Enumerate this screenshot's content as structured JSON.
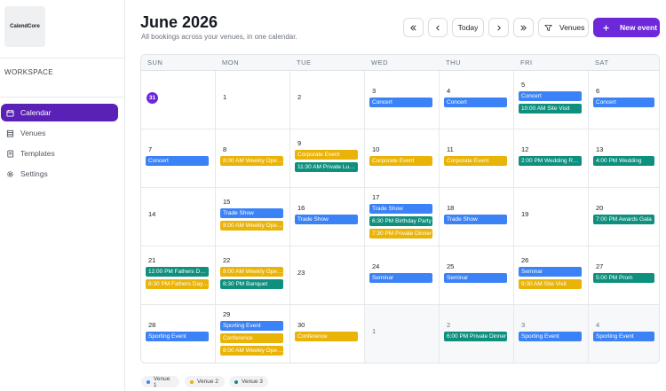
{
  "sidebar": {
    "logo": "CalendCore",
    "workspace_label": "WORKSPACE",
    "items": [
      {
        "label": "Calendar",
        "icon": "calendar-icon"
      },
      {
        "label": "Venues",
        "icon": "building-icon"
      },
      {
        "label": "Templates",
        "icon": "template-icon"
      },
      {
        "label": "Settings",
        "icon": "gear-icon"
      }
    ]
  },
  "header": {
    "title": "June 2026",
    "subtitle": "All bookings across your venues, in one calendar.",
    "today_label": "Today",
    "venues_label": "Venues",
    "new_event_label": "New event"
  },
  "calendar": {
    "weekdays": [
      "SUN",
      "MON",
      "TUE",
      "WED",
      "THU",
      "FRI",
      "SAT"
    ],
    "weeks": [
      [
        {
          "day": "31",
          "today": true,
          "events": []
        },
        {
          "day": "1",
          "events": []
        },
        {
          "day": "2",
          "events": []
        },
        {
          "day": "3",
          "events": [
            {
              "text": "Concert",
              "venue": 1
            }
          ]
        },
        {
          "day": "4",
          "events": [
            {
              "text": "Concert",
              "venue": 1
            }
          ]
        },
        {
          "day": "5",
          "events": [
            {
              "text": "Concert",
              "venue": 1
            },
            {
              "text": "10:00 AM Site Visit",
              "venue": 3
            }
          ]
        },
        {
          "day": "6",
          "events": [
            {
              "text": "Concert",
              "venue": 1
            }
          ]
        }
      ],
      [
        {
          "day": "7",
          "events": [
            {
              "text": "Concert",
              "venue": 1
            }
          ]
        },
        {
          "day": "8",
          "events": [
            {
              "text": "8:00 AM Weekly Oper...",
              "venue": 2
            }
          ]
        },
        {
          "day": "9",
          "events": [
            {
              "text": "Corporate Event",
              "venue": 2
            },
            {
              "text": "11:30 AM Private Lunch",
              "venue": 3
            }
          ]
        },
        {
          "day": "10",
          "events": [
            {
              "text": "Corporate Event",
              "venue": 2
            }
          ]
        },
        {
          "day": "11",
          "events": [
            {
              "text": "Corporate Event",
              "venue": 2
            }
          ]
        },
        {
          "day": "12",
          "events": [
            {
              "text": "2:00 PM Wedding Reh...",
              "venue": 3
            }
          ]
        },
        {
          "day": "13",
          "events": [
            {
              "text": "4:00 PM Wedding",
              "venue": 3
            }
          ]
        }
      ],
      [
        {
          "day": "14",
          "events": []
        },
        {
          "day": "15",
          "events": [
            {
              "text": "Trade Show",
              "venue": 1
            },
            {
              "text": "8:00 AM Weekly Oper...",
              "venue": 2
            }
          ]
        },
        {
          "day": "16",
          "events": [
            {
              "text": "Trade Show",
              "venue": 1
            }
          ]
        },
        {
          "day": "17",
          "events": [
            {
              "text": "Trade Show",
              "venue": 1
            },
            {
              "text": "6:30 PM Birthday Party",
              "venue": 3
            },
            {
              "text": "7:30 PM Private Dinner",
              "venue": 2
            }
          ]
        },
        {
          "day": "18",
          "events": [
            {
              "text": "Trade Show",
              "venue": 1
            }
          ]
        },
        {
          "day": "19",
          "events": []
        },
        {
          "day": "20",
          "events": [
            {
              "text": "7:00 PM Awards Gala",
              "venue": 3
            }
          ]
        }
      ],
      [
        {
          "day": "21",
          "events": [
            {
              "text": "12:00 PM Fathers Day ...",
              "venue": 3
            },
            {
              "text": "8:30 PM Fathers Day ...",
              "venue": 2
            }
          ]
        },
        {
          "day": "22",
          "events": [
            {
              "text": "8:00 AM Weekly Oper...",
              "venue": 2
            },
            {
              "text": "8:30 PM Banquet",
              "venue": 3
            }
          ]
        },
        {
          "day": "23",
          "events": []
        },
        {
          "day": "24",
          "events": [
            {
              "text": "Seminar",
              "venue": 1
            }
          ]
        },
        {
          "day": "25",
          "events": [
            {
              "text": "Seminar",
              "venue": 1
            }
          ]
        },
        {
          "day": "26",
          "events": [
            {
              "text": "Seminar",
              "venue": 1
            },
            {
              "text": "9:30 AM Site Visit",
              "venue": 2
            }
          ]
        },
        {
          "day": "27",
          "events": [
            {
              "text": "5:00 PM Prom",
              "venue": 3
            }
          ]
        }
      ],
      [
        {
          "day": "28",
          "events": [
            {
              "text": "Sporting Event",
              "venue": 1
            }
          ]
        },
        {
          "day": "29",
          "events": [
            {
              "text": "Sporting Event",
              "venue": 1
            },
            {
              "text": "Conference",
              "venue": 2
            },
            {
              "text": "8:00 AM Weekly Oper...",
              "venue": 2
            }
          ]
        },
        {
          "day": "30",
          "events": [
            {
              "text": "Conference",
              "venue": 2
            }
          ]
        },
        {
          "day": "1",
          "other": true,
          "events": []
        },
        {
          "day": "2",
          "other": true,
          "events": [
            {
              "text": "6:00 PM Private Dinner",
              "venue": 3
            }
          ]
        },
        {
          "day": "3",
          "other": true,
          "events": [
            {
              "text": "Sporting Event",
              "venue": 1
            }
          ]
        },
        {
          "day": "4",
          "other": true,
          "events": [
            {
              "text": "Sporting Event",
              "venue": 1
            }
          ]
        }
      ]
    ]
  },
  "legend": [
    {
      "label": "Venue 1",
      "color": "#3b82f6"
    },
    {
      "label": "Venue 2",
      "color": "#eab308"
    },
    {
      "label": "Venue 3",
      "color": "#0f8f7e"
    }
  ]
}
